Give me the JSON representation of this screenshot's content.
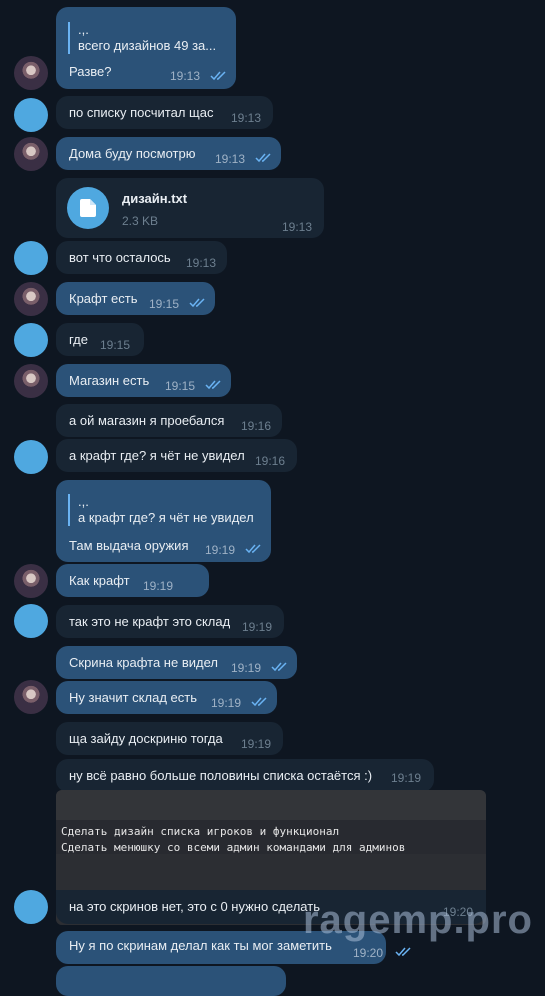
{
  "messages": [
    {
      "reply_name": ".,.",
      "reply_text": "всего дизайнов 49 за...",
      "text": "Разве?",
      "time": "19:13"
    },
    {
      "text": "по списку посчитал щас",
      "time": "19:13"
    },
    {
      "text": "Дома буду посмотрю",
      "time": "19:13"
    },
    {
      "file_name": "дизайн.txt",
      "file_size": "2.3 KB",
      "time": "19:13"
    },
    {
      "text": "вот что осталось",
      "time": "19:13"
    },
    {
      "text": "Крафт есть",
      "time": "19:15"
    },
    {
      "text": "где",
      "time": "19:15"
    },
    {
      "text": "Магазин есть",
      "time": "19:15"
    },
    {
      "text": "а ой магазин я проебался",
      "time": "19:16"
    },
    {
      "text": "а крафт где? я чёт не увидел",
      "time": "19:16"
    },
    {
      "reply_name": ".,.",
      "reply_text": "а крафт где? я чёт не увидел",
      "text": "Там выдача оружия",
      "time": "19:19"
    },
    {
      "text": "Как крафт",
      "time": "19:19"
    },
    {
      "text": "так это не крафт это склад",
      "time": "19:19"
    },
    {
      "text": "Скрина крафта не видел",
      "time": "19:19"
    },
    {
      "text": "Ну значит склад есть",
      "time": "19:19"
    },
    {
      "text": "ща зайду доскриню тогда",
      "time": "19:19"
    },
    {
      "text": "ну всё равно больше половины списка остаётся :)",
      "time": "19:19"
    },
    {
      "screenshot_lines": [
        "Сделать дизайн списка игроков и функционал",
        "Сделать менюшку со всеми админ командами для админов"
      ],
      "text": "на это скринов нет, это с 0 нужно сделать",
      "time": "19:20"
    },
    {
      "text": "Ну я по скринам делал как ты мог заметить",
      "time": "19:20"
    }
  ],
  "watermark": "ragemp.pro",
  "colors": {
    "background": "#0e1621",
    "outgoing": "#2b5278",
    "incoming": "#182533",
    "accent": "#6ab3f3"
  }
}
